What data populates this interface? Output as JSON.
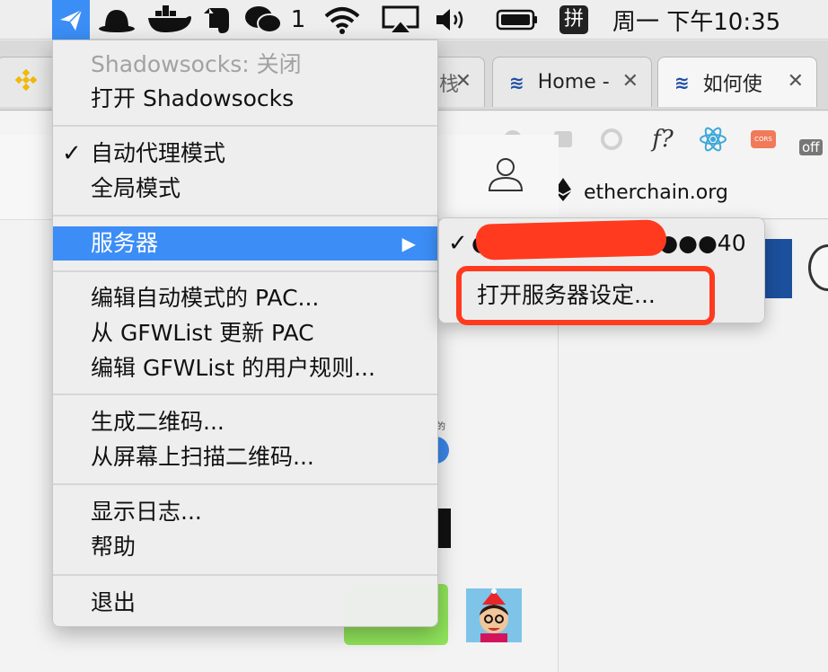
{
  "menubar": {
    "wechat_badge": "1",
    "input_method": "拼",
    "clock": "周一 下午10:35"
  },
  "tabs": [
    {
      "label": "Home -",
      "close": "✕"
    },
    {
      "label": "如何使",
      "close": "✕"
    }
  ],
  "partial_tab_close": "✕",
  "partial_tab_text": "栈",
  "bookmark": {
    "label": "etherchain.org"
  },
  "extensions": [
    "f?",
    "CORS",
    "off"
  ],
  "colors": {
    "accent": "#3c8df6",
    "annotation": "#ff3a1e"
  },
  "menu": {
    "status": "Shadowsocks: 关闭",
    "toggle": "打开 Shadowsocks",
    "check": "✓",
    "mode_auto": "自动代理模式",
    "mode_global": "全局模式",
    "servers": "服务器",
    "servers_arrow": "▶",
    "edit_pac": "编辑自动模式的 PAC...",
    "update_pac": "从 GFWList 更新 PAC",
    "edit_rules": "编辑 GFWList 的用户规则...",
    "gen_qr": "生成二维码...",
    "scan_qr": "从屏幕上扫描二维码...",
    "show_log": "显示日志...",
    "help": "帮助",
    "quit": "退出"
  },
  "submenu": {
    "check": "✓",
    "server_entry": "●● .29.●●●●●●●●40",
    "open_settings": "打开服务器设定..."
  },
  "page": {
    "tiny_text": "的"
  }
}
